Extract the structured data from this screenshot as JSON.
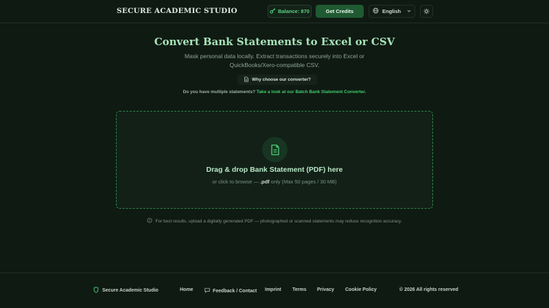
{
  "header": {
    "brand": "SECURE ACADEMIC STUDIO",
    "balance_label": "Balance: 870",
    "get_credits_label": "Get Credits",
    "language": "English",
    "icons": {
      "balance": "key-icon",
      "language": "globe-icon",
      "theme": "sun-icon"
    }
  },
  "hero": {
    "title": "Convert Bank Statements to Excel or CSV",
    "subtitle": "Mask personal data locally. Extract transactions securely into Excel or QuickBooks/Xero-compatible CSV.",
    "why_button_label": "Why choose our converter?",
    "multi_question": "Do you have multiple statements?",
    "multi_link": "Take a look at our Batch Bank Statement Converter."
  },
  "dropzone": {
    "title": "Drag & drop Bank Statement (PDF) here",
    "sub_prefix": "or click to browse —",
    "sub_ext": ".pdf",
    "sub_suffix": "only (Max 50 pages / 30 MB)"
  },
  "hint": "For best results, upload a digitally generated PDF — photographed or scanned statements may reduce recognition accuracy.",
  "footer": {
    "brand": "Secure Academic Studio",
    "links": {
      "home": "Home",
      "feedback": "Feedback / Contact",
      "imprint": "Imprint",
      "terms": "Terms",
      "privacy": "Privacy",
      "cookie": "Cookie Policy"
    },
    "copyright": "© 2026 All rights reserved"
  },
  "colors": {
    "background": "#0f1a13",
    "accent": "#3fcf6b",
    "button": "#1f5a32",
    "title": "#a6e3b7"
  }
}
